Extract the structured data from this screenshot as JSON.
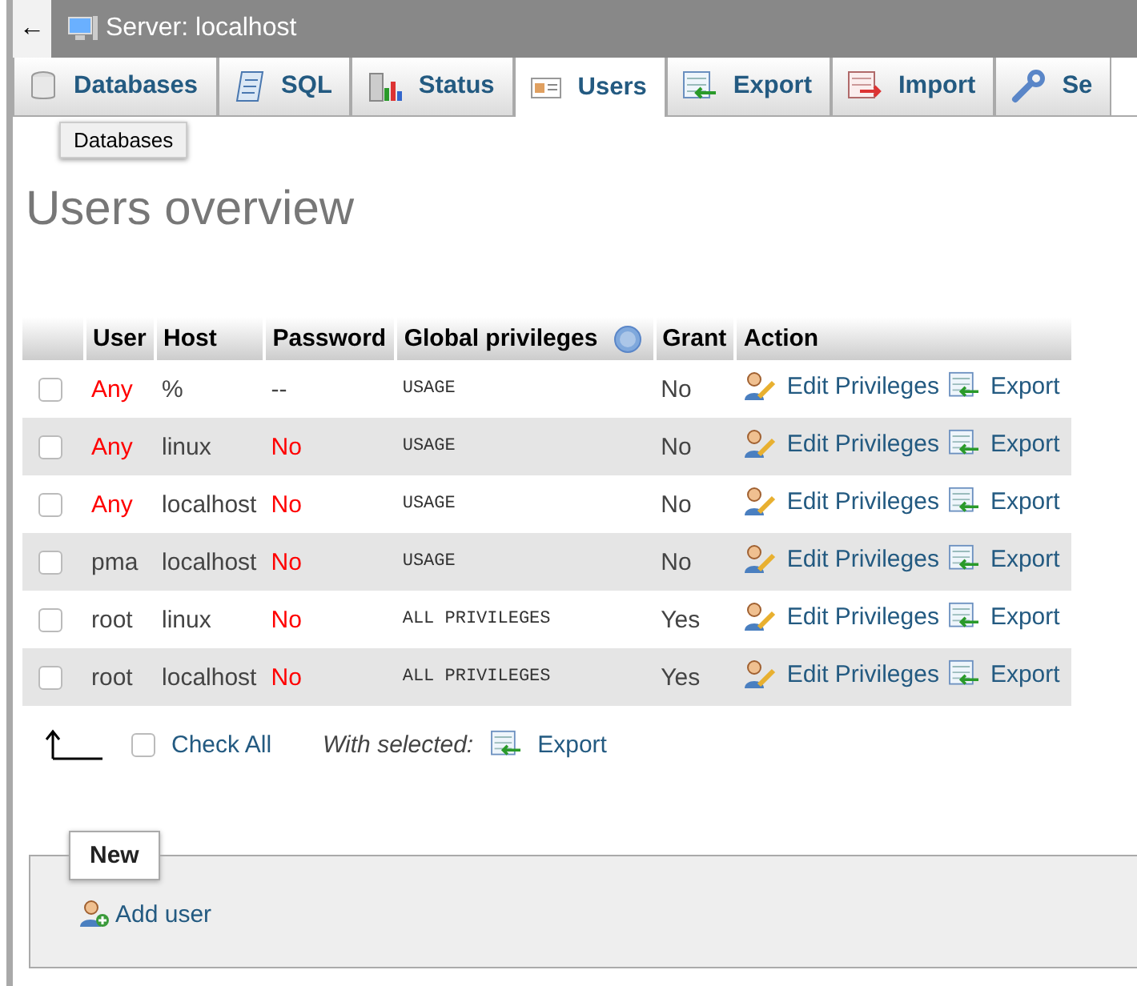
{
  "header": {
    "back": "←",
    "title": "Server: localhost"
  },
  "tabs": [
    {
      "label": "Databases",
      "selected": false
    },
    {
      "label": "SQL",
      "selected": false
    },
    {
      "label": "Status",
      "selected": false
    },
    {
      "label": "Users",
      "selected": true
    },
    {
      "label": "Export",
      "selected": false
    },
    {
      "label": "Import",
      "selected": false
    },
    {
      "label": "Se",
      "selected": false
    }
  ],
  "tooltip": "Databases",
  "heading": "Users overview",
  "table": {
    "columns": [
      "User",
      "Host",
      "Password",
      "Global privileges",
      "Grant",
      "Action"
    ],
    "rows": [
      {
        "checked": false,
        "user": "Any",
        "user_warning": true,
        "host": "%",
        "password": "--",
        "password_warning": false,
        "privileges": "USAGE",
        "grant": "No",
        "edit": "Edit Privileges",
        "export": "Export"
      },
      {
        "checked": false,
        "user": "Any",
        "user_warning": true,
        "host": "linux",
        "password": "No",
        "password_warning": true,
        "privileges": "USAGE",
        "grant": "No",
        "edit": "Edit Privileges",
        "export": "Export"
      },
      {
        "checked": false,
        "user": "Any",
        "user_warning": true,
        "host": "localhost",
        "password": "No",
        "password_warning": true,
        "privileges": "USAGE",
        "grant": "No",
        "edit": "Edit Privileges",
        "export": "Export"
      },
      {
        "checked": false,
        "user": "pma",
        "user_warning": false,
        "host": "localhost",
        "password": "No",
        "password_warning": true,
        "privileges": "USAGE",
        "grant": "No",
        "edit": "Edit Privileges",
        "export": "Export"
      },
      {
        "checked": false,
        "user": "root",
        "user_warning": false,
        "host": "linux",
        "password": "No",
        "password_warning": true,
        "privileges": "ALL PRIVILEGES",
        "grant": "Yes",
        "edit": "Edit Privileges",
        "export": "Export"
      },
      {
        "checked": false,
        "user": "root",
        "user_warning": false,
        "host": "localhost",
        "password": "No",
        "password_warning": true,
        "privileges": "ALL PRIVILEGES",
        "grant": "Yes",
        "edit": "Edit Privileges",
        "export": "Export"
      }
    ]
  },
  "bulk": {
    "check_all": "Check All",
    "checked": false,
    "with_selected": "With selected:",
    "export": "Export"
  },
  "new_section": {
    "legend": "New",
    "add_user": "Add user"
  }
}
